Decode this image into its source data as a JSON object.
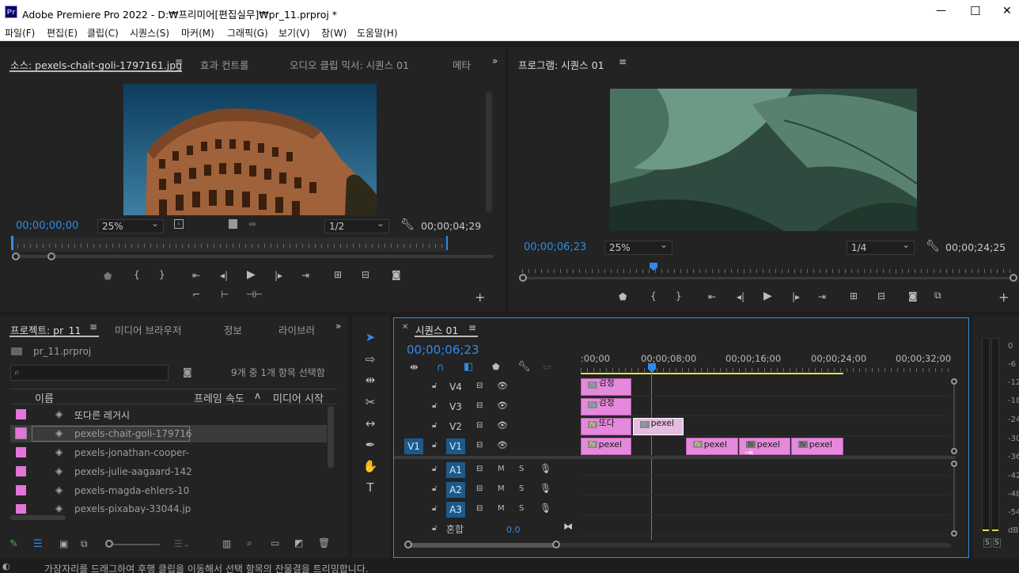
{
  "window": {
    "title": "Adobe Premiere Pro 2022 - D:₩프리미어[편집실무]₩pr_11.prproj *",
    "min": "—",
    "max": "☐",
    "close": "✕",
    "logo": "Pr"
  },
  "menu": [
    "파일(F)",
    "편집(E)",
    "클립(C)",
    "시퀀스(S)",
    "마커(M)",
    "그래픽(G)",
    "보기(V)",
    "창(W)",
    "도움말(H)"
  ],
  "source": {
    "tabs": [
      "소스: pexels-chait-goli-1797161.jpg",
      "효과 컨트롤",
      "오디오 클립 믹서: 시퀀스 01",
      "메타"
    ],
    "timecode": "00;00;00;00",
    "zoom": "25%",
    "resolution": "1/2",
    "duration": "00;00;04;29"
  },
  "program": {
    "tab": "프로그램: 시퀀스 01",
    "timecode": "00;00;06;23",
    "zoom": "25%",
    "resolution": "1/4",
    "duration": "00;00;24;25"
  },
  "project": {
    "tabs": [
      "프로젝트: pr_11",
      "미디어 브라우저",
      "정보",
      "라이브러"
    ],
    "file": "pr_11.prproj",
    "search_placeholder": "",
    "selection_info": "9개 중 1개 항목 선택함",
    "columns": [
      "이름",
      "프레임 속도",
      "미디어 시작"
    ],
    "items": [
      "또다른 레거시",
      "pexels-chait-goli-179716",
      "pexels-jonathan-cooper-",
      "pexels-julie-aagaard-142",
      "pexels-magda-ehlers-10",
      "pexels-pixabay-33044.jp"
    ]
  },
  "timeline": {
    "tab": "시퀀스 01",
    "timecode": "00;00;06;23",
    "ruler": [
      ":00;00",
      "00;00;08;00",
      "00;00;16;00",
      "00;00;24;00",
      "00;00;32;00"
    ],
    "video_tracks": [
      "V4",
      "V3",
      "V2",
      "V1"
    ],
    "audio_tracks": [
      "A1",
      "A2",
      "A3"
    ],
    "source_v": "V1",
    "source_a": [
      "A1",
      "A2",
      "A3"
    ],
    "mix_label": "혼합",
    "mix_value": "0.0",
    "mute": "M",
    "solo": "S",
    "clips": {
      "v4": "검정",
      "v3": "검정",
      "v2a": "또다",
      "v2b": "pexel",
      "v1a": "pexel",
      "v1b": "pexel",
      "v1c": "pexel",
      "v1d": "pexel"
    },
    "fx": "fx"
  },
  "meter": {
    "scale": [
      "0",
      "-6",
      "-12",
      "-18",
      "-24",
      "-30",
      "-36",
      "-42",
      "-48",
      "-54",
      "dB"
    ],
    "solo_l": "S",
    "solo_r": "S"
  },
  "status": "가장자리를 드래그하여 후행 클립을 이동해서 선택 항목의 잔물결을 트리밍합니다."
}
